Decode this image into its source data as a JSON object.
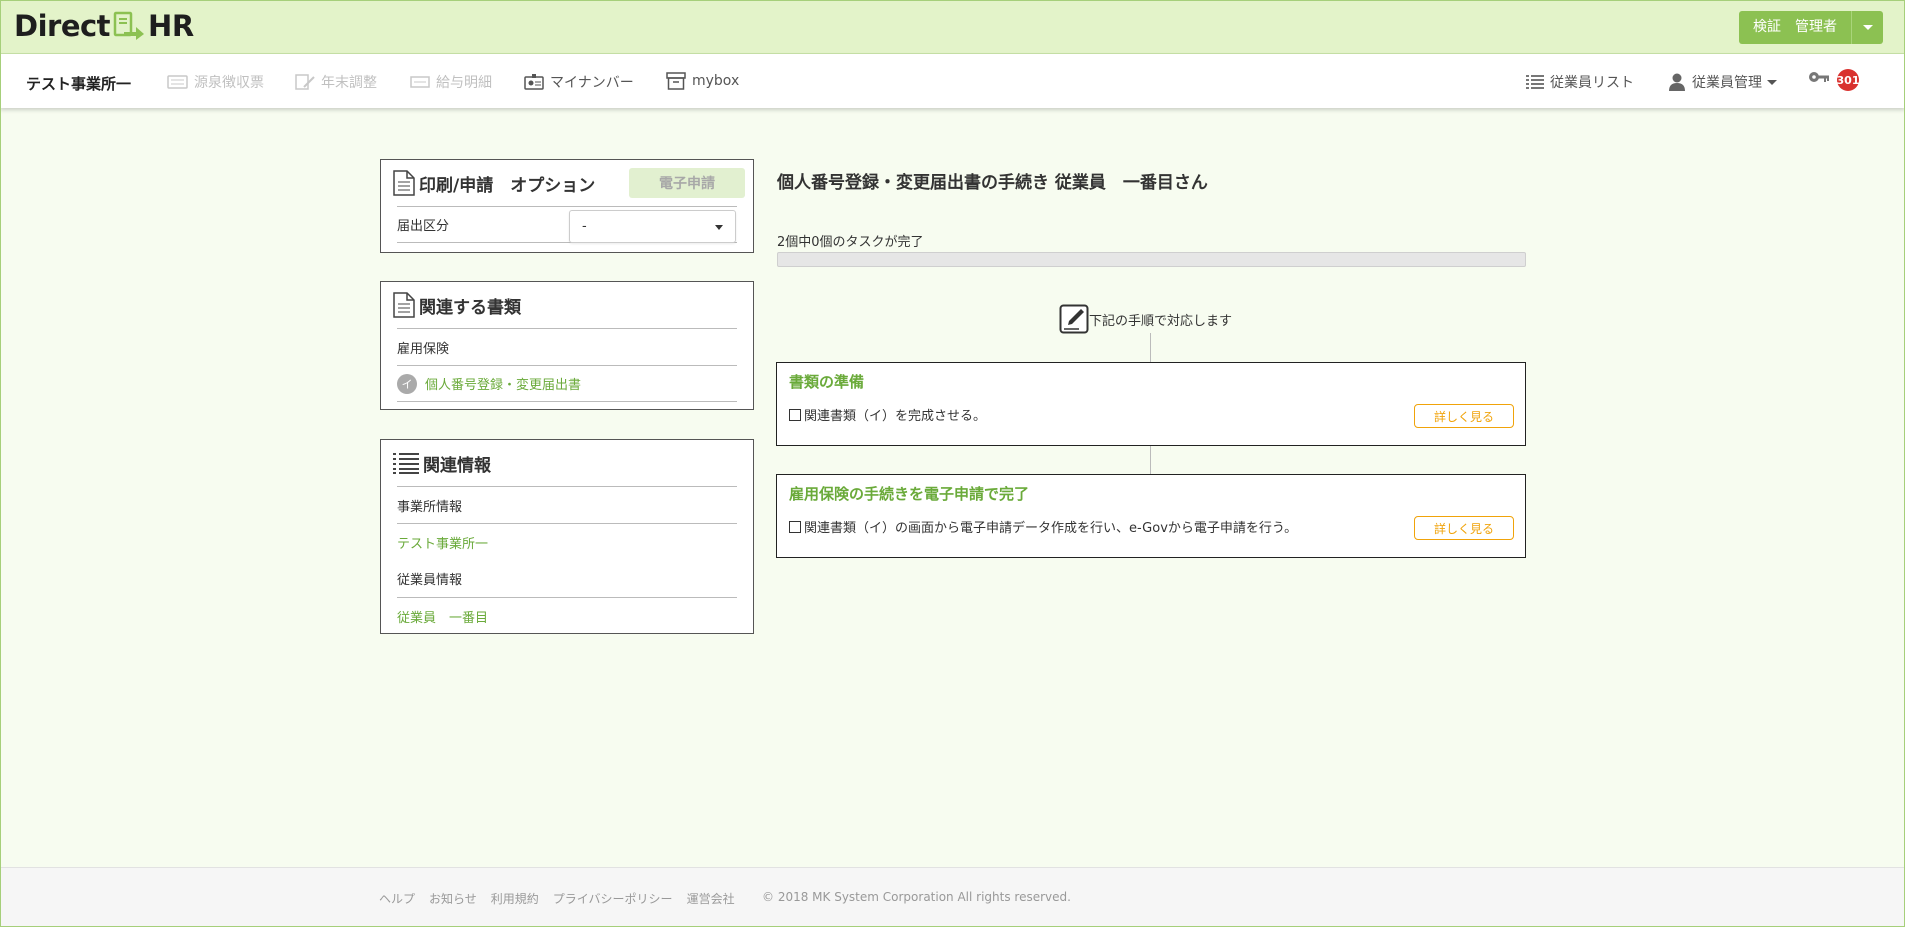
{
  "brand": {
    "logo_left": "Direct",
    "logo_right": "HR",
    "user_button": "検証　管理者"
  },
  "nav": {
    "office": "テスト事業所一",
    "items": [
      {
        "label": "源泉徴収票",
        "enabled": false
      },
      {
        "label": "年末調整",
        "enabled": false
      },
      {
        "label": "給与明細",
        "enabled": false
      },
      {
        "label": "マイナンバー",
        "enabled": true
      },
      {
        "label": "mybox",
        "enabled": true
      }
    ],
    "employee_list": "従業員リスト",
    "employee_manage": "従業員管理",
    "badge_count": "301"
  },
  "print_panel": {
    "title": "印刷/申請　オプション",
    "e_apply_button": "電子申請",
    "field_label": "届出区分",
    "select_value": "-"
  },
  "docs_panel": {
    "title": "関連する書類",
    "section": "雇用保険",
    "doc_letter": "イ",
    "doc_link": "個人番号登録・変更届出書"
  },
  "info_panel": {
    "title": "関連情報",
    "office_label": "事業所情報",
    "office_link": "テスト事業所一",
    "employee_label": "従業員情報",
    "employee_link": "従業員　一番目"
  },
  "main": {
    "title": "個人番号登録・変更届出書の手続き  従業員　一番目さん",
    "progress_label": "2個中0個のタスクが完了",
    "progress_done": 0,
    "progress_total": 2,
    "step_head": "下記の手順で対応します",
    "tasks": [
      {
        "title": "書類の準備",
        "desc": "関連書類（イ）を完成させる。",
        "button": "詳しく見る"
      },
      {
        "title": "雇用保険の手続きを電子申請で完了",
        "desc": "関連書類（イ）の画面から電子申請データ作成を行い、e-Govから電子申請を行う。",
        "button": "詳しく見る"
      }
    ]
  },
  "footer": {
    "links": [
      "ヘルプ",
      "お知らせ",
      "利用規約",
      "プライバシーポリシー",
      "運営会社"
    ],
    "copyright": "© 2018 MK System Corporation All rights reserved."
  },
  "colors": {
    "accent": "#8cc152",
    "link": "#6aaa3a",
    "warning": "#f0a30a",
    "badge": "#d9322f",
    "brandbar": "#e3f3c9"
  }
}
